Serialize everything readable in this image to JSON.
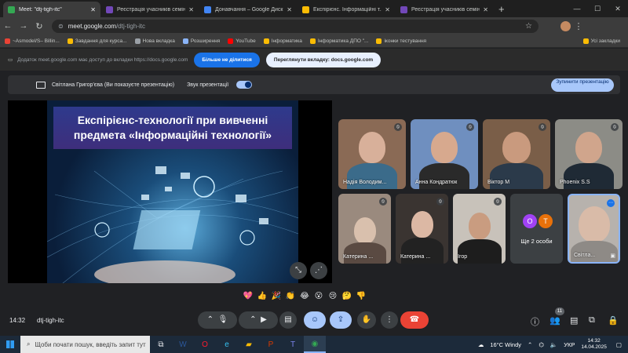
{
  "browser": {
    "tabs": [
      {
        "title": "Meet: \"dtj-tigh-itc\"",
        "active": true,
        "color": "#34a853"
      },
      {
        "title": "Реєстрація учасників семінару",
        "active": false,
        "color": "#7248b9"
      },
      {
        "title": "Донавчання – Google Диск",
        "active": false,
        "color": "#4285f4"
      },
      {
        "title": "Експірієнс. Інформаційні т...",
        "active": false,
        "color": "#fbbc04"
      },
      {
        "title": "Реєстрація учасників семінару",
        "active": false,
        "color": "#7248b9"
      }
    ],
    "url_domain": "meet.google.com",
    "url_path": "/dtj-tigh-itc",
    "bookmarks": [
      "~Asmodel/S– Billin...",
      "Завдання для курса...",
      "Нова вкладка",
      "Розширення",
      "YouTube",
      "Інформатика",
      "Інформатика ДПО \"...",
      "іконки тестування"
    ],
    "bookmarks_right": "Усі закладки"
  },
  "sharebar": {
    "text": "Додаток meet.google.com має доступ до вкладки https://docs.google.com",
    "stop_sharing_label": "Більше не ділитися",
    "switch_label": "Переглянути вкладку: docs.google.com"
  },
  "presenting": {
    "presenter_text": "Світлана Григор'єва (Ви показуєте презентацію)",
    "audio_label": "Звук презентації",
    "stop_label": "Зупинити презентацію"
  },
  "slide": {
    "title": "Експірієнс-технології при вивченні предмета «Інформаційні технології»"
  },
  "participants": [
    {
      "name": "Надія Володим...",
      "bg": "#8a6a55",
      "face": "#d8b09a",
      "cloth": "#3b6b8a"
    },
    {
      "name": "Анна Кондратюк",
      "bg": "#6f8fbf",
      "face": "#d7a98e",
      "cloth": "#2a2a2a"
    },
    {
      "name": "Віктор М",
      "bg": "#7a5e48",
      "face": "#c99a7e",
      "cloth": "#2b3a4a"
    },
    {
      "name": "Phoenix S.S",
      "bg": "#8c8c86",
      "face": "#d0a58c",
      "cloth": "#1f2a35"
    },
    {
      "name": "Катерина ...",
      "bg": "#9a8a7e",
      "face": "#d9c0ad",
      "cloth": "#5a4a42"
    },
    {
      "name": "Катерина ...",
      "bg": "#3a3431",
      "face": "#dcb8a4",
      "cloth": "#222"
    },
    {
      "name": "Ігор",
      "bg": "#c8c2ba",
      "face": "#c99c80",
      "cloth": "#1d1d1d"
    },
    {
      "name": "Світла...",
      "bg": "#b7b2ad",
      "face": "#d9bba8",
      "cloth": "#8e8a86"
    }
  ],
  "more": {
    "label": "Ще 2 особи",
    "initial1": "O",
    "initial2": "T",
    "color1": "#a142f4",
    "color2": "#e8710a"
  },
  "reactions": [
    "💖",
    "👍",
    "🎉",
    "👏",
    "😂",
    "😮",
    "😢",
    "🤔",
    "👎"
  ],
  "bottom": {
    "time": "14:32",
    "meeting_id": "dtj-tigh-itc",
    "participants_count": "11"
  },
  "taskbar": {
    "search_placeholder": "Щоби почати пошук, введіть запит тут",
    "weather": "16°C Windy",
    "lang": "УКР",
    "time": "14:32",
    "date": "14.04.2025"
  }
}
